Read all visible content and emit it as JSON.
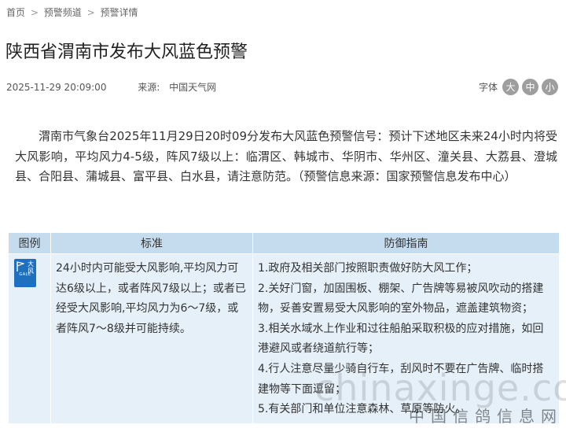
{
  "breadcrumb": {
    "home": "首页",
    "channel": "预警频道",
    "detail": "预警详情",
    "separator": ">"
  },
  "article": {
    "title": "陕西省渭南市发布大风蓝色预警",
    "datetime": "2025-11-29 20:09:00",
    "source_label": "来源:",
    "source_value": "中国天气网",
    "body": "渭南市气象台2025年11月29日20时09分发布大风蓝色预警信号：预计下述地区未来24小时内将受大风影响，平均风力4-5级，阵风7级以上：临渭区、韩城市、华阴市、华州区、潼关县、大荔县、澄城县、合阳县、蒲城县、富平县、白水县，请注意防范。（预警信息来源：国家预警信息发布中心）"
  },
  "font_size": {
    "label": "字体",
    "large": "大",
    "medium": "中",
    "small": "小"
  },
  "table": {
    "headers": [
      "图例",
      "标准",
      "防御指南"
    ],
    "icon": {
      "cn_text": "大风",
      "en_text": "GALE",
      "color": "#1f6fbf"
    },
    "standard": "24小时内可能受大风影响,平均风力可达6级以上，或者阵风7级以上；或者已经受大风影响,平均风力为6～7级，或者阵风7～8级并可能持续。",
    "guide": [
      "1.政府及相关部门按照职责做好防大风工作；",
      "2.关好门窗，加固围板、棚架、广告牌等易被风吹动的搭建物，妥善安置易受大风影响的室外物品，遮盖建筑物资；",
      "3.相关水域水上作业和过往船舶采取积极的应对措施，如回港避风或者绕道航行等；",
      "4.行人注意尽量少骑自行车，刮风时不要在广告牌、临时搭建物等下面逗留；",
      "5.有关部门和单位注意森林、草原等防火。"
    ]
  },
  "watermark": {
    "en": "chinaxinge.com",
    "cn": "中国信鸽信息网"
  }
}
